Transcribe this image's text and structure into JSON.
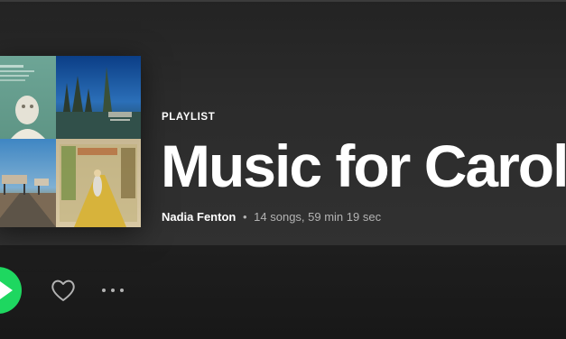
{
  "playlist": {
    "type_label": "PLAYLIST",
    "title": "Music for Carol",
    "owner": "Nadia Fenton",
    "separator": "•",
    "stats": "14 songs, 59 min 19 sec"
  },
  "cover": {
    "tiles": [
      {
        "name": "album-cover-classical"
      },
      {
        "name": "album-cover-blue-sky"
      },
      {
        "name": "album-cover-desert-road"
      },
      {
        "name": "album-cover-yellow-brick-road"
      }
    ]
  },
  "actions": {
    "play": "play-icon",
    "like": "heart-icon",
    "more": "more-options-icon"
  },
  "colors": {
    "accent": "#1ed760",
    "background": "#181818",
    "text_primary": "#ffffff",
    "text_secondary": "#b3b3b3"
  }
}
